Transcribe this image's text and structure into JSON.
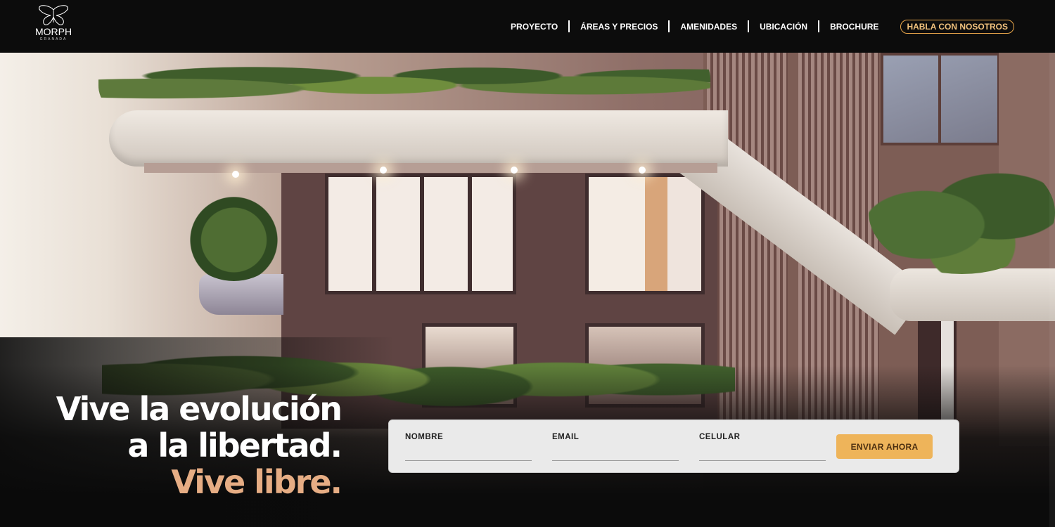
{
  "brand": {
    "name": "MORPH",
    "subtitle": "GRANADA",
    "logo_icon": "butterfly-icon"
  },
  "nav": {
    "items": [
      {
        "label": "PROYECTO",
        "active": true
      },
      {
        "label": "ÁREAS Y PRECIOS",
        "active": false
      },
      {
        "label": "AMENIDADES",
        "active": false
      },
      {
        "label": "UBICACIÓN",
        "active": false
      },
      {
        "label": "BROCHURE",
        "active": false
      }
    ],
    "cta_label": "HABLA CON NOSOTROS"
  },
  "hero": {
    "line1": "Vive la evolución",
    "line2": "a la libertad.",
    "line3": "Vive libre."
  },
  "form": {
    "name_label": "NOMBRE",
    "name_value": "",
    "email_label": "EMAIL",
    "email_value": "",
    "phone_label": "CELULAR",
    "phone_value": "",
    "submit_label": "ENVIAR AHORA"
  },
  "colors": {
    "accent": "#eeb45a",
    "cta_border": "#e8a64a",
    "headline_accent": "#e6ad84",
    "header_bg": "#0c0c0c"
  }
}
